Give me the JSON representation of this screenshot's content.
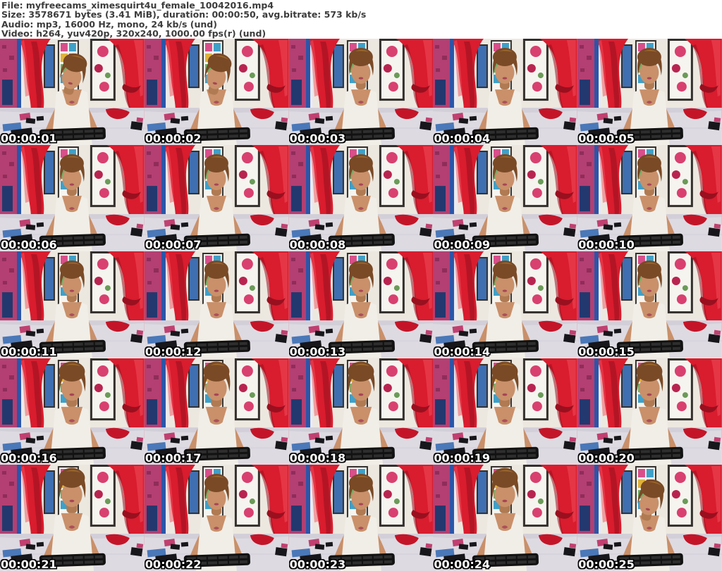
{
  "header": {
    "lines": [
      "File: myfreecams_ximesquirt4u_female_10042016.mp4",
      "Size: 3578671 bytes (3.41 MiB), duration: 00:00:50, avg.bitrate: 573 kb/s",
      "Audio: mp3, 16000 Hz, mono, 24 kb/s (und)",
      "Video: h264, yuv420p, 320x240, 1000.00 fps(r) (und)"
    ]
  },
  "grid": {
    "rows": 5,
    "columns": 5,
    "thumbnails": [
      {
        "timestamp": "00:00:01",
        "variant": "down"
      },
      {
        "timestamp": "00:00:02",
        "variant": "down"
      },
      {
        "timestamp": "00:00:03",
        "variant": "front"
      },
      {
        "timestamp": "00:00:04",
        "variant": "front"
      },
      {
        "timestamp": "00:00:05",
        "variant": "front"
      },
      {
        "timestamp": "00:00:06",
        "variant": "front"
      },
      {
        "timestamp": "00:00:07",
        "variant": "front"
      },
      {
        "timestamp": "00:00:08",
        "variant": "front"
      },
      {
        "timestamp": "00:00:09",
        "variant": "front"
      },
      {
        "timestamp": "00:00:10",
        "variant": "front"
      },
      {
        "timestamp": "00:00:11",
        "variant": "front"
      },
      {
        "timestamp": "00:00:12",
        "variant": "front"
      },
      {
        "timestamp": "00:00:13",
        "variant": "front"
      },
      {
        "timestamp": "00:00:14",
        "variant": "front"
      },
      {
        "timestamp": "00:00:15",
        "variant": "front"
      },
      {
        "timestamp": "00:00:16",
        "variant": "close"
      },
      {
        "timestamp": "00:00:17",
        "variant": "close"
      },
      {
        "timestamp": "00:00:18",
        "variant": "close"
      },
      {
        "timestamp": "00:00:19",
        "variant": "close"
      },
      {
        "timestamp": "00:00:20",
        "variant": "close"
      },
      {
        "timestamp": "00:00:21",
        "variant": "close"
      },
      {
        "timestamp": "00:00:22",
        "variant": "front"
      },
      {
        "timestamp": "00:00:23",
        "variant": "front"
      },
      {
        "timestamp": "00:00:24",
        "variant": "close"
      },
      {
        "timestamp": "00:00:25",
        "variant": "down"
      }
    ]
  },
  "colors": {
    "header_text": "#3c3c3c",
    "header_bg": "#ffffff",
    "timestamp_text": "#ffffff",
    "timestamp_outline": "#000000",
    "wall": "#ece8e0",
    "pink_wall": "#b43f72",
    "door_frame_blue": "#2b55a8",
    "curtain": "#d91c2e",
    "curtain_dark": "#99101f",
    "curtain_light": "#f2505e",
    "bed": "#dedae2",
    "bed_shadow": "#cfcbd6",
    "keyboard": "#121212",
    "keyboard_keys": "#2e2e2e",
    "skin": "#c9906a",
    "hair": "#7a4a26",
    "hair_light": "#a5702f",
    "top": "#f1eee7",
    "lips": "#a84456"
  }
}
